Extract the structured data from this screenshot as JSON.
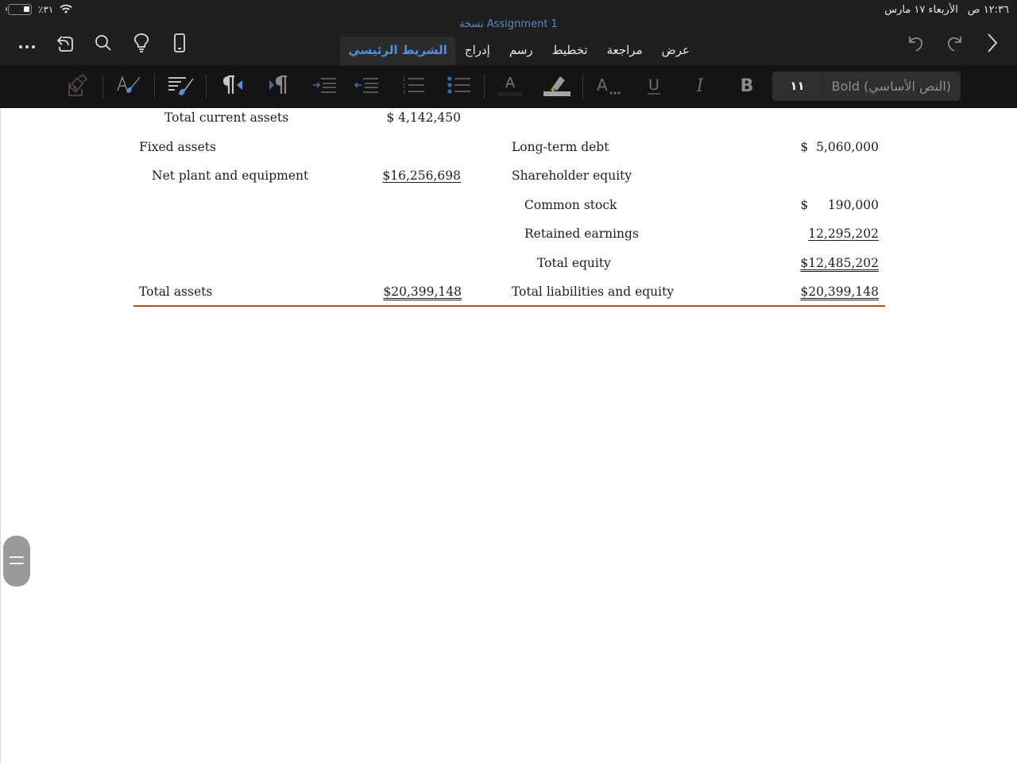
{
  "status_bar": {
    "battery_percent": "٪٣١",
    "time": "١٢:٣٦ ص",
    "date": "الأربعاء ١٧ مارس"
  },
  "header": {
    "document_title": "نسخة Assignment 1",
    "tabs": [
      {
        "label": "الشريط الرئيسي",
        "active": true
      },
      {
        "label": "إدراج",
        "active": false
      },
      {
        "label": "رسم",
        "active": false
      },
      {
        "label": "تخطيط",
        "active": false
      },
      {
        "label": "مراجعة",
        "active": false
      },
      {
        "label": "عرض",
        "active": false
      }
    ],
    "left_icons": [
      "more-icon",
      "share-icon",
      "search-icon",
      "lightbulb-icon",
      "mobile-view-icon"
    ],
    "right_icons": [
      "undo-icon",
      "redo-icon",
      "chevron-right-icon"
    ]
  },
  "ribbon": {
    "font_size": "١١",
    "style_name": "(النص الأساسي) Bold",
    "buttons": [
      "clear-formatting",
      "styles",
      "paragraph-styles",
      "rtl-paragraph",
      "ltr-paragraph",
      "increase-indent",
      "decrease-indent",
      "numbered-list",
      "bulleted-list",
      "font-color",
      "highlight-color",
      "more-font-options",
      "underline",
      "italic",
      "bold"
    ],
    "bold_label": "B",
    "italic_label": "I",
    "underline_label": "U",
    "font_color_label": "A",
    "more_font_label": "A...",
    "accent_color": "#4f8fe0"
  },
  "document": {
    "left_column": [
      {
        "label": "Total current assets",
        "value": "$  4,142,450",
        "indent": 2,
        "underline": "none"
      },
      {
        "label": "Fixed assets",
        "value": "",
        "indent": 0,
        "underline": "none"
      },
      {
        "label": "Net plant and equipment",
        "value": "$16,256,698",
        "indent": 1,
        "underline": "single"
      },
      {
        "label": "Total assets",
        "value": "$20,399,148",
        "indent": 0,
        "underline": "double"
      }
    ],
    "right_column": [
      {
        "label": "Long-term debt",
        "value": "$  5,060,000",
        "indent": 0,
        "underline": "none"
      },
      {
        "label": "Shareholder equity",
        "value": "",
        "indent": 0,
        "underline": "none"
      },
      {
        "label": "Common stock",
        "value": "$     190,000",
        "indent": 1,
        "underline": "none"
      },
      {
        "label": "Retained earnings",
        "value": "12,295,202",
        "indent": 1,
        "underline": "single"
      },
      {
        "label": "Total equity",
        "value": "$12,485,202",
        "indent": 2,
        "underline": "double"
      },
      {
        "label": "Total liabilities and equity",
        "value": "$20,399,148",
        "indent": 0,
        "underline": "double"
      }
    ],
    "rule_color": "#a8501d"
  }
}
